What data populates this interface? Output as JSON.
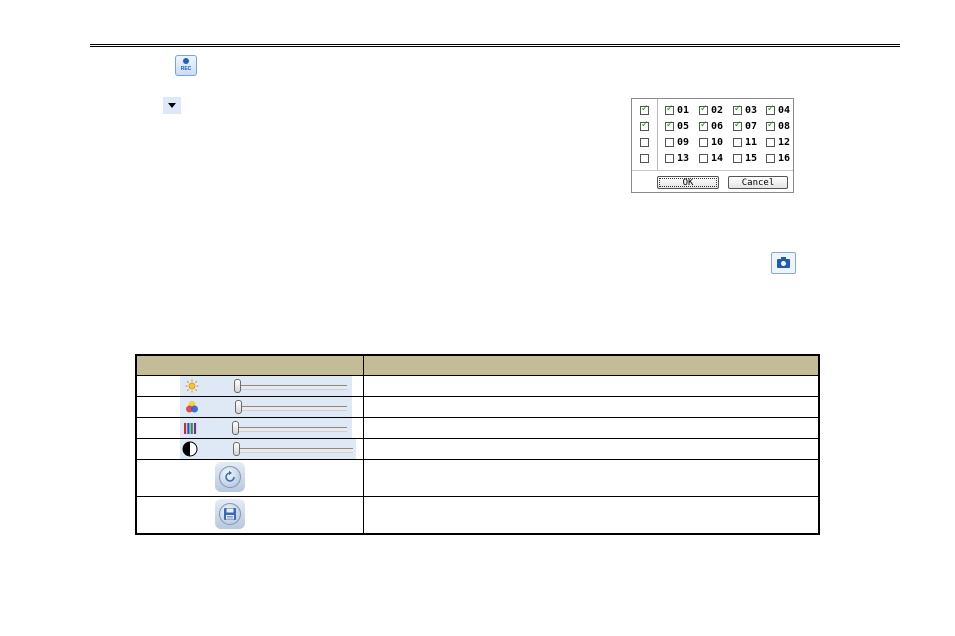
{
  "rec_button": {
    "label": "REC"
  },
  "channel_dialog": {
    "rows": [
      {
        "all_checked": true,
        "channels": [
          {
            "label": "01",
            "checked": true
          },
          {
            "label": "02",
            "checked": true
          },
          {
            "label": "03",
            "checked": true
          },
          {
            "label": "04",
            "checked": true
          }
        ]
      },
      {
        "all_checked": true,
        "channels": [
          {
            "label": "05",
            "checked": true
          },
          {
            "label": "06",
            "checked": true
          },
          {
            "label": "07",
            "checked": true
          },
          {
            "label": "08",
            "checked": true
          }
        ]
      },
      {
        "all_checked": false,
        "channels": [
          {
            "label": "09",
            "checked": false
          },
          {
            "label": "10",
            "checked": false
          },
          {
            "label": "11",
            "checked": false
          },
          {
            "label": "12",
            "checked": false
          }
        ]
      },
      {
        "all_checked": false,
        "channels": [
          {
            "label": "13",
            "checked": false
          },
          {
            "label": "14",
            "checked": false
          },
          {
            "label": "15",
            "checked": false
          },
          {
            "label": "16",
            "checked": false
          }
        ]
      }
    ],
    "ok_label": "OK",
    "cancel_label": "Cancel"
  },
  "color_table": {
    "headers": [
      "",
      ""
    ],
    "sliders": [
      {
        "icon": "brightness-icon",
        "level": 0
      },
      {
        "icon": "hue-icon",
        "level": 0
      },
      {
        "icon": "saturation-icon",
        "level": 0
      },
      {
        "icon": "contrast-icon",
        "level": 0
      }
    ],
    "buttons": [
      {
        "icon": "refresh-icon"
      },
      {
        "icon": "save-icon"
      }
    ],
    "descriptions": [
      "",
      "",
      "",
      "",
      "",
      ""
    ]
  },
  "colors": {
    "header_bg": "#c4bc96",
    "slider_bg": "#dfe9f6",
    "check_green": "#1a8a1a",
    "icon_blue": "#1f5bb5"
  }
}
